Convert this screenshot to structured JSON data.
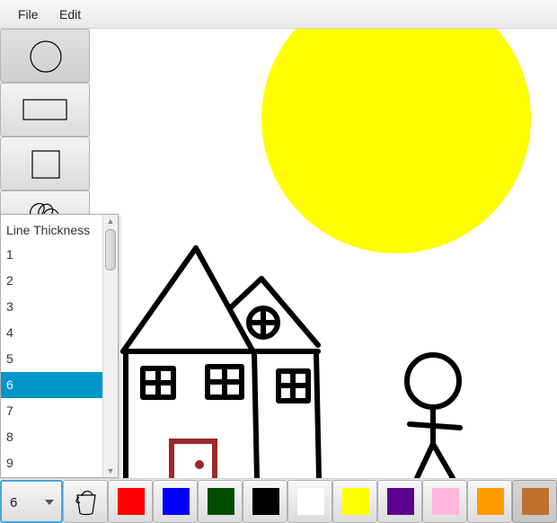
{
  "menu": {
    "file_label": "File",
    "edit_label": "Edit"
  },
  "tools": [
    {
      "name": "circle-tool",
      "icon": "circle-icon",
      "selected": true
    },
    {
      "name": "rectangle-tool",
      "icon": "rectangle-icon",
      "selected": false
    },
    {
      "name": "square-tool",
      "icon": "square-icon",
      "selected": false
    },
    {
      "name": "freehand-tool",
      "icon": "scribble-icon",
      "selected": false
    }
  ],
  "line_thickness": {
    "header": "Line Thickness",
    "options": [
      "1",
      "2",
      "3",
      "4",
      "5",
      "6",
      "7",
      "8",
      "9"
    ],
    "selected": "6",
    "current_value": "6"
  },
  "fill_tool": {
    "icon": "paint-bucket-icon"
  },
  "palette": [
    {
      "name": "red",
      "hex": "#ff0000"
    },
    {
      "name": "blue",
      "hex": "#0000ff"
    },
    {
      "name": "dark-green",
      "hex": "#004d00"
    },
    {
      "name": "black",
      "hex": "#000000"
    },
    {
      "name": "white",
      "hex": "#ffffff"
    },
    {
      "name": "yellow",
      "hex": "#ffff00"
    },
    {
      "name": "purple",
      "hex": "#5e0090"
    },
    {
      "name": "pink",
      "hex": "#ffb6dc"
    },
    {
      "name": "orange",
      "hex": "#ff9c00"
    },
    {
      "name": "brown",
      "hex": "#c0712e",
      "selected": true
    }
  ],
  "drawing": {
    "sun_color": "#ffff00",
    "house_stroke": "#000000",
    "door_color": "#9b2a2a",
    "figure_stroke": "#000000"
  }
}
